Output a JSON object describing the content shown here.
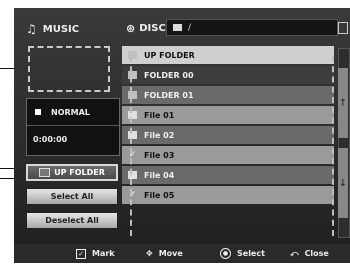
{
  "left_panel": {
    "title": "MUSIC",
    "status": {
      "mode": "NORMAL",
      "time": "0:00:00"
    },
    "buttons": {
      "up_folder": "UP FOLDER",
      "select_all": "Select All",
      "deselect_all": "Deselect All"
    }
  },
  "disc": {
    "label": "DISC",
    "path": "/"
  },
  "list": {
    "items": [
      {
        "name": "UP FOLDER",
        "icon": "folder-icon"
      },
      {
        "name": "FOLDER 00",
        "icon": "folder-icon"
      },
      {
        "name": "FOLDER 01",
        "icon": "folder-icon"
      },
      {
        "name": "File 01",
        "icon": "file-icon"
      },
      {
        "name": "File 02",
        "icon": "file-icon"
      },
      {
        "name": "File 03",
        "icon": "check-icon"
      },
      {
        "name": "File 04",
        "icon": "file-icon"
      },
      {
        "name": "File 05",
        "icon": "check-icon"
      }
    ]
  },
  "bottom_bar": {
    "mark": "Mark",
    "move": "Move",
    "select": "Select",
    "close": "Close"
  },
  "colors": {
    "background": "#2a2a2a",
    "highlight": "#3d3d3d",
    "text": "#f0f0f0"
  }
}
